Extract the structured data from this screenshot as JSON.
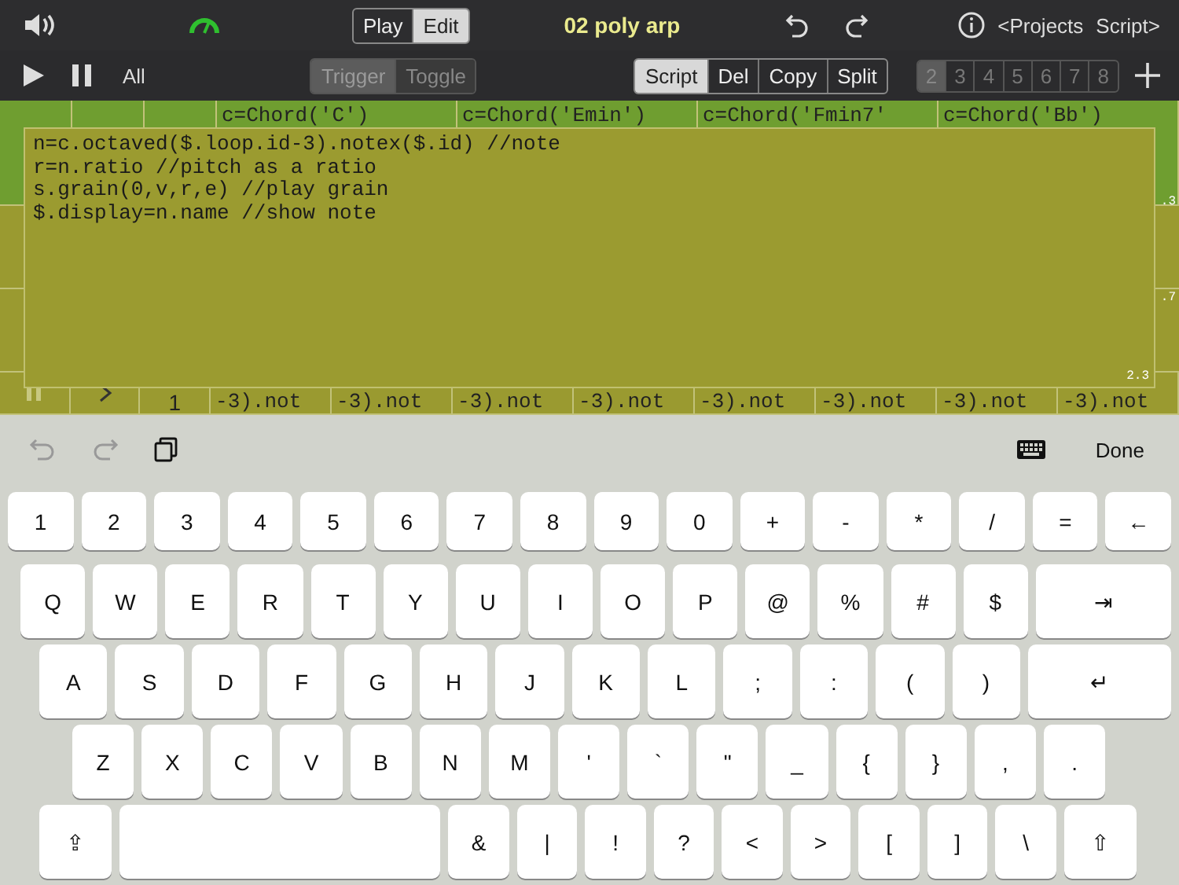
{
  "top_bar": {
    "mode_toggle": [
      {
        "label": "Play",
        "selected": false
      },
      {
        "label": "Edit",
        "selected": true
      }
    ],
    "title": "02 poly arp",
    "projects_link": "<Projects",
    "script_link": "Script>"
  },
  "transport": {
    "all": "All",
    "trigger_toggle": [
      {
        "label": "Trigger",
        "selected": true
      },
      {
        "label": "Toggle",
        "selected": false
      }
    ],
    "actions": [
      {
        "label": "Script",
        "selected": true
      },
      {
        "label": "Del",
        "selected": false
      },
      {
        "label": "Copy",
        "selected": false
      },
      {
        "label": "Split",
        "selected": false
      }
    ],
    "pages": [
      {
        "label": "2",
        "selected": true
      },
      {
        "label": "3",
        "selected": false
      },
      {
        "label": "4",
        "selected": false
      },
      {
        "label": "5",
        "selected": false
      },
      {
        "label": "6",
        "selected": false
      },
      {
        "label": "7",
        "selected": false
      },
      {
        "label": "8",
        "selected": false
      }
    ]
  },
  "grid": {
    "top_cells": [
      "c=Chord('C')",
      "c=Chord('Emin')",
      "c=Chord('Fmin7'",
      "c=Chord('Bb')"
    ],
    "side_values": [
      ".3",
      ".7"
    ],
    "bottom_index": "1",
    "bottom_cells": [
      "-3).not",
      "-3).not",
      "-3).not",
      "-3).not",
      "-3).not",
      "-3).not",
      "-3).not",
      "-3).not"
    ]
  },
  "editor": {
    "lines": [
      "n=c.octaved($.loop.id-3).notex($.id) //note",
      "r=n.ratio //pitch as a ratio",
      "s.grain(0,v,r,e) //play grain",
      "$.display=n.name //show note"
    ],
    "corner_value": "2.3"
  },
  "keyboard_bar": {
    "done": "Done"
  },
  "keyboard": [
    [
      {
        "label": "1"
      },
      {
        "label": "2"
      },
      {
        "label": "3"
      },
      {
        "label": "4"
      },
      {
        "label": "5"
      },
      {
        "label": "6"
      },
      {
        "label": "7"
      },
      {
        "label": "8"
      },
      {
        "label": "9"
      },
      {
        "label": "0"
      },
      {
        "label": "+"
      },
      {
        "label": "-"
      },
      {
        "label": "*"
      },
      {
        "label": "/"
      },
      {
        "label": "="
      },
      {
        "label": "←"
      }
    ],
    [
      {
        "label": "Q"
      },
      {
        "label": "W"
      },
      {
        "label": "E"
      },
      {
        "label": "R"
      },
      {
        "label": "T"
      },
      {
        "label": "Y"
      },
      {
        "label": "U"
      },
      {
        "label": "I"
      },
      {
        "label": "O"
      },
      {
        "label": "P"
      },
      {
        "label": "@"
      },
      {
        "label": "%"
      },
      {
        "label": "#"
      },
      {
        "label": "$"
      },
      {
        "label": "⇥",
        "kind": "wide"
      }
    ],
    [
      {
        "label": "A"
      },
      {
        "label": "S"
      },
      {
        "label": "D"
      },
      {
        "label": "F"
      },
      {
        "label": "G"
      },
      {
        "label": "H"
      },
      {
        "label": "J"
      },
      {
        "label": "K"
      },
      {
        "label": "L"
      },
      {
        "label": ";"
      },
      {
        "label": ":"
      },
      {
        "label": "("
      },
      {
        "label": ")"
      },
      {
        "label": "↵",
        "kind": "wide"
      }
    ],
    [
      {
        "label": "Z"
      },
      {
        "label": "X"
      },
      {
        "label": "C"
      },
      {
        "label": "V"
      },
      {
        "label": "B"
      },
      {
        "label": "N"
      },
      {
        "label": "M"
      },
      {
        "label": "'"
      },
      {
        "label": "`"
      },
      {
        "label": "\""
      },
      {
        "label": "_"
      },
      {
        "label": "{"
      },
      {
        "label": "}"
      },
      {
        "label": ","
      },
      {
        "label": "."
      }
    ],
    [
      {
        "label": "⇪",
        "kind": "shift"
      },
      {
        "kind": "space"
      },
      {
        "label": "&"
      },
      {
        "label": "|"
      },
      {
        "label": "!"
      },
      {
        "label": "?"
      },
      {
        "label": "<"
      },
      {
        "label": ">"
      },
      {
        "label": "["
      },
      {
        "label": "]"
      },
      {
        "label": "\\"
      },
      {
        "label": "⇧",
        "kind": "shift"
      }
    ]
  ]
}
